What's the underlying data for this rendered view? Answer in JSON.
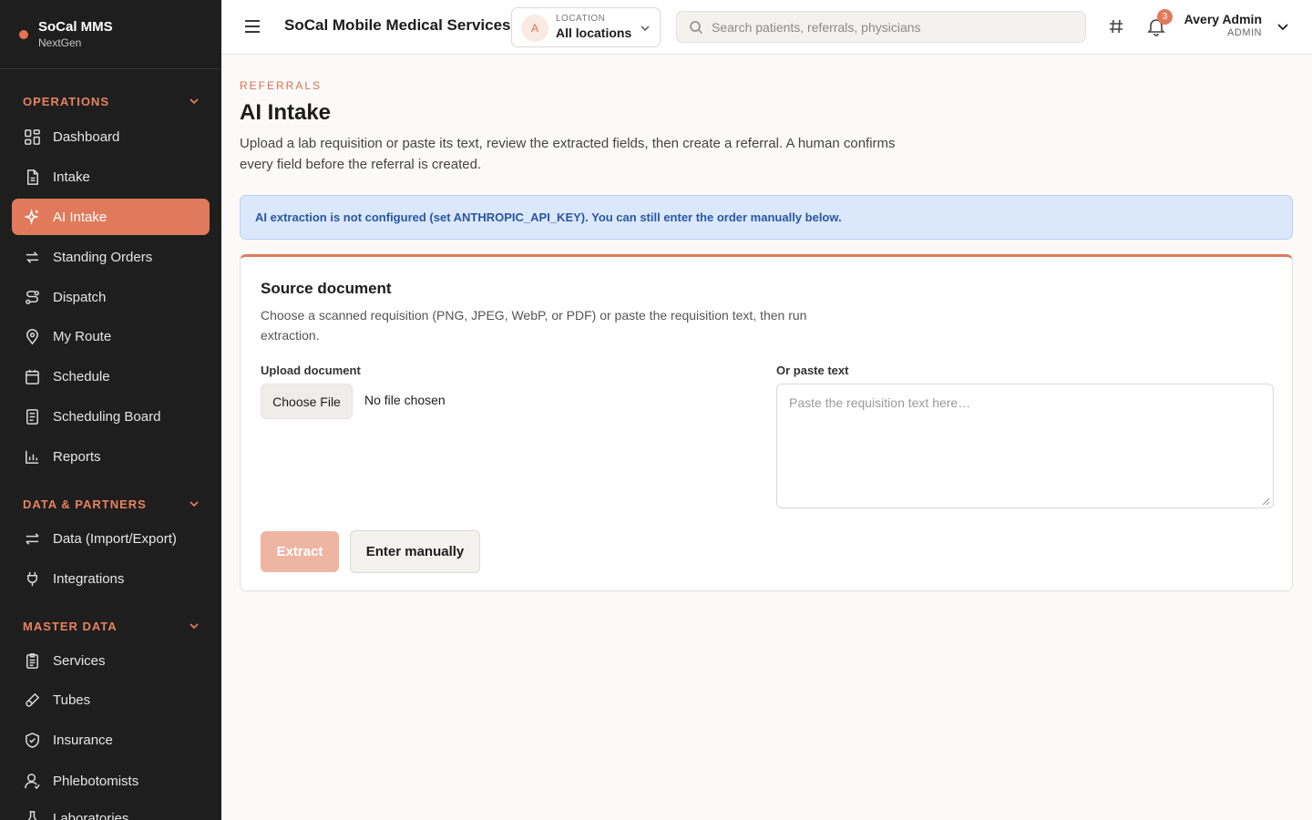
{
  "brand": {
    "name": "SoCal MMS",
    "subtitle": "NextGen"
  },
  "sidebar": {
    "sections": [
      {
        "label": "OPERATIONS"
      },
      {
        "label": "DATA & PARTNERS"
      },
      {
        "label": "MASTER DATA"
      }
    ],
    "items": [
      {
        "label": "Dashboard",
        "icon": "dashboard-icon"
      },
      {
        "label": "Intake",
        "icon": "document-icon"
      },
      {
        "label": "AI Intake",
        "icon": "sparkle-icon",
        "active": true
      },
      {
        "label": "Standing Orders",
        "icon": "repeat-icon"
      },
      {
        "label": "Dispatch",
        "icon": "route-icon"
      },
      {
        "label": "My Route",
        "icon": "map-pin-icon"
      },
      {
        "label": "Schedule",
        "icon": "calendar-icon"
      },
      {
        "label": "Scheduling Board",
        "icon": "board-icon"
      },
      {
        "label": "Reports",
        "icon": "bar-chart-icon"
      },
      {
        "label": "Data (Import/Export)",
        "icon": "arrows-icon"
      },
      {
        "label": "Integrations",
        "icon": "plug-icon"
      },
      {
        "label": "Services",
        "icon": "clipboard-icon"
      },
      {
        "label": "Tubes",
        "icon": "tube-icon"
      },
      {
        "label": "Insurance",
        "icon": "shield-icon"
      },
      {
        "label": "Phlebotomists",
        "icon": "user-icon"
      },
      {
        "label": "Laboratories",
        "icon": "flask-icon"
      }
    ]
  },
  "header": {
    "app_title": "SoCal Mobile Medical Services",
    "location": {
      "avatar": "A",
      "label": "LOCATION",
      "value": "All locations"
    },
    "search_placeholder": "Search patients, referrals, physicians",
    "notification_count": "3",
    "user": {
      "name": "Avery Admin",
      "role": "ADMIN"
    }
  },
  "page": {
    "eyebrow": "REFERRALS",
    "title": "AI Intake",
    "description": "Upload a lab requisition or paste its text, review the extracted fields, then create a referral. A human confirms every field before the referral is created.",
    "alert": "AI extraction is not configured (set ANTHROPIC_API_KEY). You can still enter the order manually below."
  },
  "card": {
    "title": "Source document",
    "description": "Choose a scanned requisition (PNG, JPEG, WebP, or PDF) or paste the requisition text, then run extraction.",
    "upload_label": "Upload document",
    "choose_file_label": "Choose File",
    "no_file_text": "No file chosen",
    "paste_label": "Or paste text",
    "paste_placeholder": "Paste the requisition text here…",
    "paste_value": "",
    "extract_label": "Extract",
    "manual_label": "Enter manually"
  },
  "colors": {
    "accent": "#e07a5a",
    "sidebar_bg": "#1e1e1e",
    "alert_bg": "#dbe8fb",
    "alert_text": "#2856a3"
  }
}
